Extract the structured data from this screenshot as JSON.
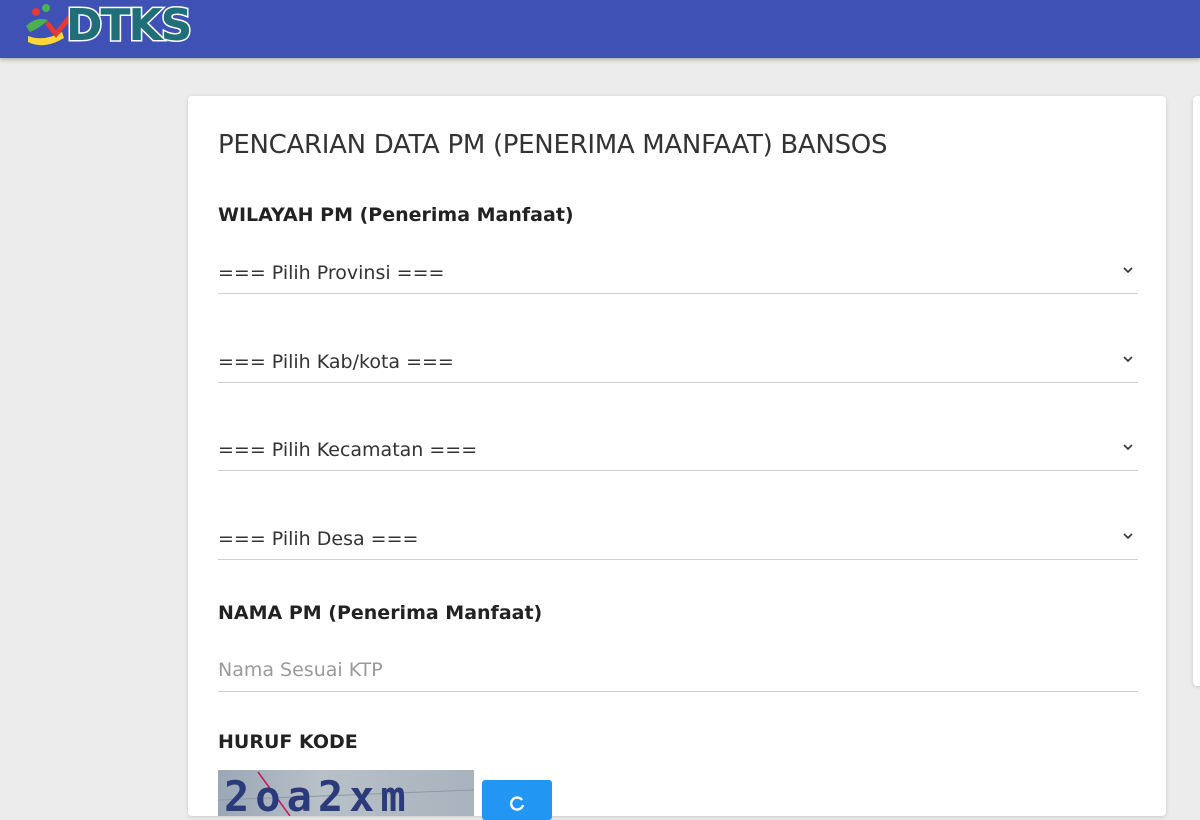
{
  "header": {
    "logo_text": "DTKS",
    "bar_color": "#3f51b5"
  },
  "form": {
    "title": "PENCARIAN DATA PM (PENERIMA MANFAAT) BANSOS",
    "wilayah_label": "WILAYAH PM (Penerima Manfaat)",
    "selects": {
      "provinsi": "=== Pilih Provinsi ===",
      "kabkota": "=== Pilih Kab/kota ===",
      "kecamatan": "=== Pilih Kecamatan ===",
      "desa": "=== Pilih Desa ==="
    },
    "nama_label": "NAMA PM (Penerima Manfaat)",
    "nama_placeholder": "Nama Sesuai KTP",
    "nama_value": "",
    "kode_label": "HURUF KODE",
    "captcha_text": "2oa2xm",
    "refresh_icon": "refresh-icon"
  }
}
